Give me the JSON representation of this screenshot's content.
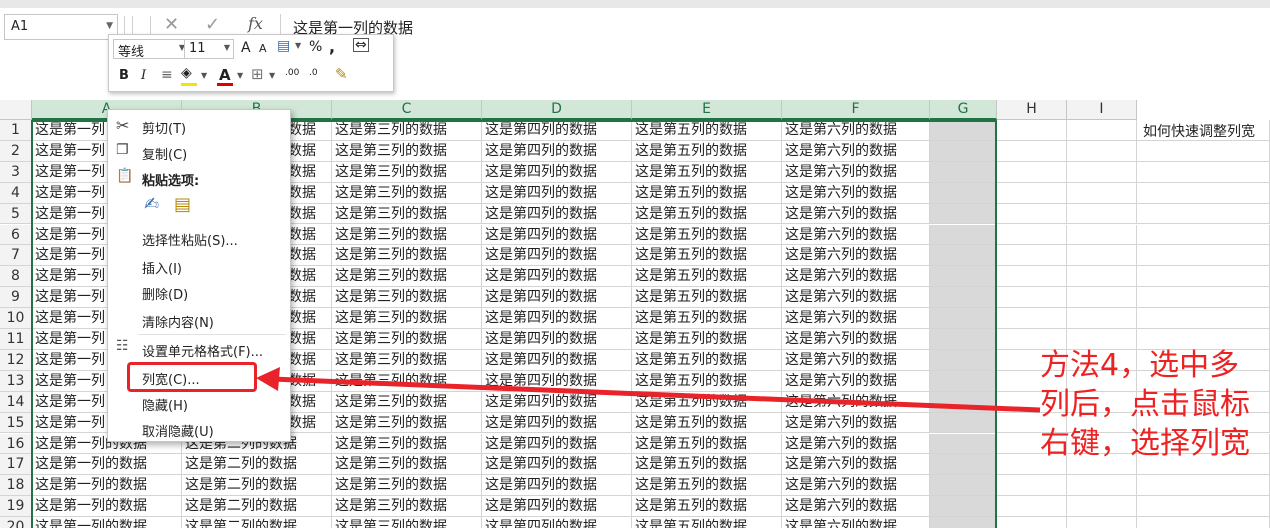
{
  "formula_bar": {
    "name_box": "A1",
    "fx": "fx",
    "cancel_icon": "✕",
    "enter_icon": "✓",
    "formula": "这是第一列的数据"
  },
  "mini_toolbar": {
    "font_name": "等线",
    "font_size": "11",
    "grow_font": "A",
    "shrink_font": "A",
    "percent": "%",
    "comma": ",",
    "bold": "B",
    "italic": "I",
    "font_color_letter": "A",
    "inc_decimal": ".00",
    "dec_decimal": ".0"
  },
  "columns": [
    "A",
    "B",
    "C",
    "D",
    "E",
    "F",
    "G",
    "H",
    "I"
  ],
  "rows": [
    "1",
    "2",
    "3",
    "4",
    "5",
    "6",
    "7",
    "8",
    "9",
    "10",
    "11",
    "12",
    "13",
    "14",
    "15",
    "16",
    "17",
    "18",
    "19",
    "20"
  ],
  "cells": {
    "A": "这是第一列的数据",
    "B": "这是第二列的数据",
    "C": "这是第三列的数据",
    "D": "这是第四列的数据",
    "E": "这是第五列的数据",
    "F": "这是第六列的数据",
    "A_clipped": "这是第一列",
    "B_clipped": "数据"
  },
  "side_note": "如何快速调整列宽",
  "context_menu": {
    "items": [
      {
        "label": "剪切(T)",
        "icon": "scissors-icon"
      },
      {
        "label": "复制(C)",
        "icon": "copy-icon"
      },
      {
        "label": "粘贴选项:",
        "icon": "paste-icon"
      },
      {
        "label": "选择性粘贴(S)..."
      },
      {
        "label": "插入(I)"
      },
      {
        "label": "删除(D)"
      },
      {
        "label": "清除内容(N)"
      },
      {
        "label": "设置单元格格式(F)...",
        "icon": "format-cells-icon"
      },
      {
        "label": "列宽(C)..."
      },
      {
        "label": "隐藏(H)"
      },
      {
        "label": "取消隐藏(U)"
      }
    ]
  },
  "annotation": "方法4，选中多列后，点击鼠标右键，选择列宽",
  "colors": {
    "selection": "#217346",
    "header_selected": "#d2e7d8",
    "annotation": "#ee2222"
  }
}
